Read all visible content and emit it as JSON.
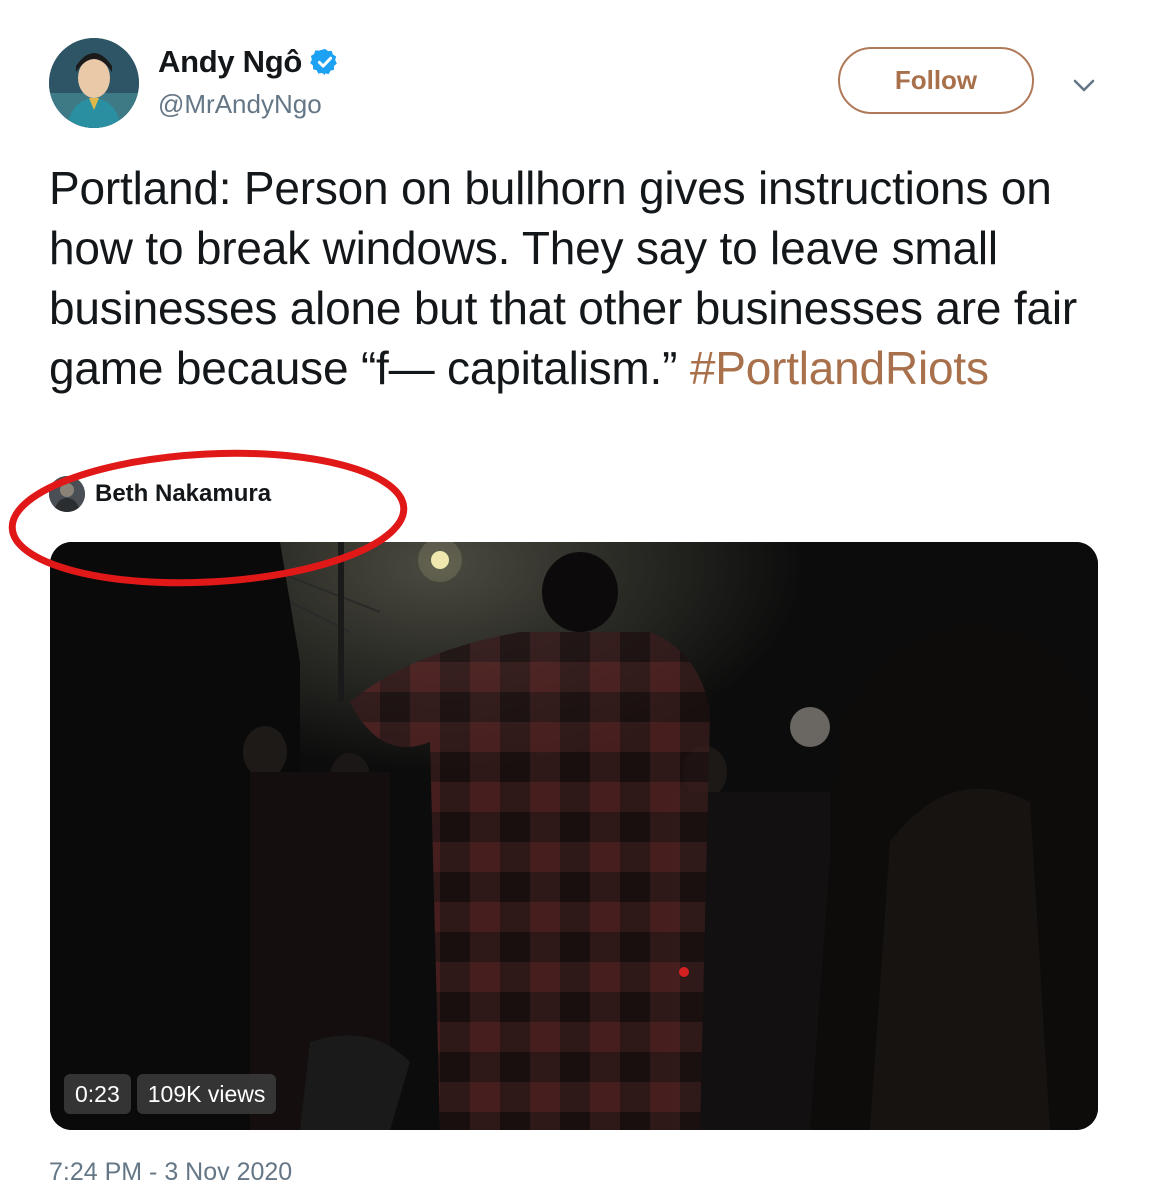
{
  "author": {
    "name": "Andy Ngô",
    "handle": "@MrAndyNgo",
    "verified": true
  },
  "follow_label": "Follow",
  "menu_icon": "chevron-down-icon",
  "tweet": {
    "text_main": "Portland: Person on bullhorn gives instructions on how to break windows. They say to leave small businesses alone but that other businesses are fair game because “f— capitalism.”",
    "hashtag": "#PortlandRiots"
  },
  "media_attribution": {
    "name": "Beth Nakamura"
  },
  "video": {
    "duration": "0:23",
    "views": "109K views"
  },
  "timestamp": "7:24 PM - 3 Nov 2020",
  "colors": {
    "accent": "#a8714c",
    "annotation": "#e01818",
    "verified": "#1da1f2",
    "secondary_text": "#657786"
  }
}
